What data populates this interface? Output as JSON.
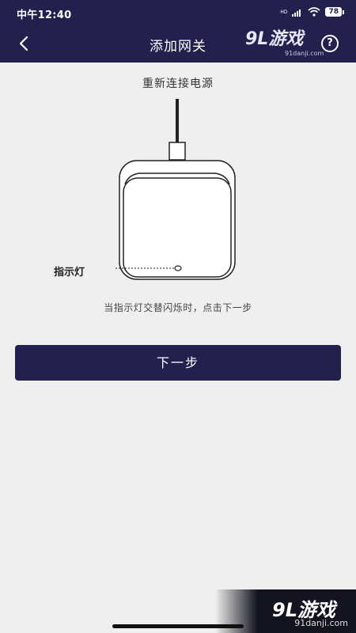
{
  "status": {
    "time": "中午12:40",
    "battery": "78",
    "network": "HD"
  },
  "nav": {
    "title": "添加网关",
    "help": "?"
  },
  "watermark": {
    "logo": "9L游戏",
    "site": "91danji.com"
  },
  "main": {
    "heading": "重新连接电源",
    "indicator_label": "指示灯",
    "instruction": "当指示灯交替闪烁时，点击下一步",
    "next_button": "下一步"
  }
}
